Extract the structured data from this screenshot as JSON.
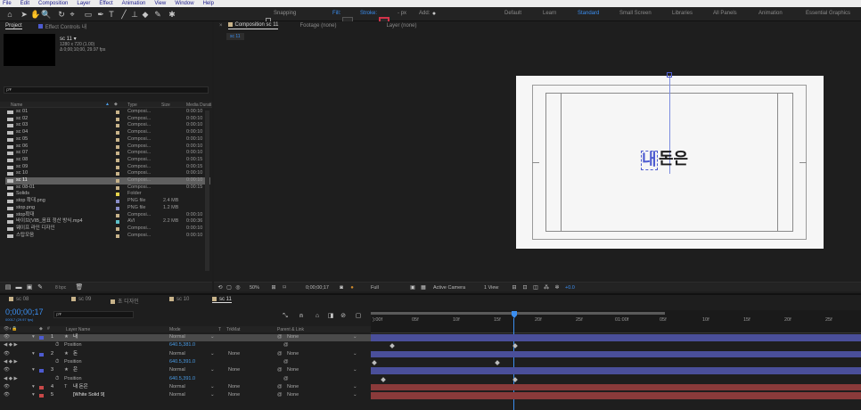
{
  "menu": [
    "File",
    "Edit",
    "Composition",
    "Layer",
    "Effect",
    "Animation",
    "View",
    "Window",
    "Help"
  ],
  "toolbar": {
    "snapping": "Snapping",
    "fill": "Fill:",
    "stroke": "Stroke:",
    "px": "- px",
    "add": "Add:",
    "workspaces": [
      "Default",
      "Learn",
      "Standard",
      "Small Screen",
      "Libraries",
      "All Panels",
      "Animation",
      "Essential Graphics"
    ],
    "active_workspace": "Standard"
  },
  "project_panel": {
    "tab_project": "Project",
    "tab_effects": "Effect Controls 내",
    "comp_name": "sc 11 ▾",
    "comp_size": "1280 x 720 (1.00)",
    "comp_dur": "Δ 0;00;10;00, 29.97 fps",
    "search_placeholder": "ρ▾",
    "columns": {
      "name": "Name",
      "type": "Type",
      "size": "Size",
      "dur": "Media Durati"
    },
    "items": [
      {
        "name": "sc 01",
        "type": "Composi...",
        "size": "",
        "dur": "0:00:10",
        "color": "#c8b38a"
      },
      {
        "name": "sc 02",
        "type": "Composi...",
        "size": "",
        "dur": "0:00:10",
        "color": "#c8b38a"
      },
      {
        "name": "sc 03",
        "type": "Composi...",
        "size": "",
        "dur": "0:00:10",
        "color": "#c8b38a"
      },
      {
        "name": "sc 04",
        "type": "Composi...",
        "size": "",
        "dur": "0:00:10",
        "color": "#c8b38a"
      },
      {
        "name": "sc 05",
        "type": "Composi...",
        "size": "",
        "dur": "0:00:10",
        "color": "#c8b38a"
      },
      {
        "name": "sc 06",
        "type": "Composi...",
        "size": "",
        "dur": "0:00:10",
        "color": "#c8b38a"
      },
      {
        "name": "sc 07",
        "type": "Composi...",
        "size": "",
        "dur": "0:00:10",
        "color": "#c8b38a"
      },
      {
        "name": "sc 08",
        "type": "Composi...",
        "size": "",
        "dur": "0:00:15",
        "color": "#c8b38a"
      },
      {
        "name": "sc 09",
        "type": "Composi...",
        "size": "",
        "dur": "0:00:15",
        "color": "#c8b38a"
      },
      {
        "name": "sc 10",
        "type": "Composi...",
        "size": "",
        "dur": "0:00:10",
        "color": "#c8b38a"
      },
      {
        "name": "sc 11",
        "type": "Composi...",
        "size": "",
        "dur": "0:00:10",
        "color": "#c8b38a",
        "selected": true
      },
      {
        "name": "sc 08-01",
        "type": "Composi...",
        "size": "",
        "dur": "0:00:15",
        "color": "#c8b38a"
      },
      {
        "name": "Solids",
        "type": "Folder",
        "size": "",
        "dur": "",
        "color": "#e6d34a"
      },
      {
        "name": "stop 확대.png",
        "type": "PNG file",
        "size": "2.4 MB",
        "dur": "",
        "color": "#8a8ec8"
      },
      {
        "name": "stop.png",
        "type": "PNG file",
        "size": "1.2 MB",
        "dur": "",
        "color": "#8a8ec8"
      },
      {
        "name": "stop확대",
        "type": "Composi...",
        "size": "",
        "dur": "0:00:10",
        "color": "#c8b38a"
      },
      {
        "name": "바이브(VIB_음표 정산 방식.mp4",
        "type": "AVI",
        "size": "2.2 MB",
        "dur": "0:00:36",
        "color": "#5ec0c8"
      },
      {
        "name": "웨이프 라인 디자인",
        "type": "Composi...",
        "size": "",
        "dur": "0:00:10",
        "color": "#c8b38a"
      },
      {
        "name": "스탑모음",
        "type": "Composi...",
        "size": "",
        "dur": "0:00:10",
        "color": "#c8b38a"
      }
    ],
    "bpc": "8 bpc"
  },
  "comp_panel": {
    "tab_comp": "Composition sc 11",
    "tab_footage": "Footage (none)",
    "tab_layer": "Layer (none)",
    "crumb": "sc 11",
    "canvas_text_highlight": "내",
    "canvas_text_rest": "돈은",
    "zoom": "50%",
    "timecode": "0;00;00;17",
    "resolution": "Full",
    "camera": "Active Camera",
    "view": "1 View",
    "exposure": "+0.0"
  },
  "timeline": {
    "tabs": [
      "sc 08",
      "sc 09",
      "초 디자인",
      "sc 10",
      "sc 11"
    ],
    "tab_colors": [
      "#c8b38a",
      "#c8b38a",
      "#c8b38a",
      "#c8b38a",
      "#c8b38a"
    ],
    "active_tab": "sc 11",
    "timecode": "0;00;00;17",
    "timecode_sub": "00017 (29.97 fps)",
    "search_placeholder": "ρ▾",
    "columns": {
      "name": "Layer Name",
      "mode": "Mode",
      "t": "T",
      "trkmat": "TrkMat",
      "parent": "Parent & Link"
    },
    "ruler": [
      "):00f",
      "05f",
      "10f",
      "15f",
      "20f",
      "25f",
      "01:00f",
      "05f",
      "10f",
      "15f",
      "20f",
      "25f"
    ],
    "layers": [
      {
        "num": "1",
        "icon": "★",
        "name": "내",
        "mode": "Normal",
        "trkmat": "",
        "parent": "None",
        "color": "#4d5bd0",
        "selected": true
      },
      {
        "sub": true,
        "name": "Position",
        "value": "640.5,381.0"
      },
      {
        "num": "2",
        "icon": "★",
        "name": "돈",
        "mode": "Normal",
        "trkmat": "None",
        "parent": "None",
        "color": "#4d5bd0"
      },
      {
        "sub": true,
        "name": "Position",
        "value": "640.5,391.0"
      },
      {
        "num": "3",
        "icon": "★",
        "name": "은",
        "mode": "Normal",
        "trkmat": "None",
        "parent": "None",
        "color": "#4d5bd0"
      },
      {
        "sub": true,
        "name": "Position",
        "value": "640.5,391.0"
      },
      {
        "num": "4",
        "icon": "T",
        "name": "내 돈은",
        "mode": "Normal",
        "trkmat": "None",
        "parent": "None",
        "color": "#c84848"
      },
      {
        "num": "5",
        "icon": "",
        "name": "[White Solid 9]",
        "mode": "Normal",
        "trkmat": "None",
        "parent": "None",
        "color": "#c84848"
      }
    ]
  }
}
